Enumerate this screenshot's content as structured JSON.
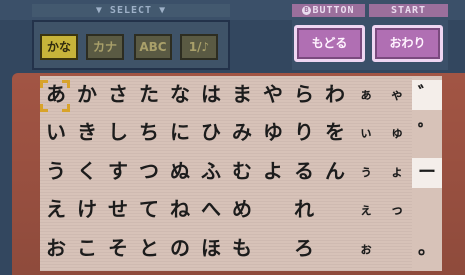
{
  "header": {
    "select_label": "▼ SELECT ▼",
    "button_letter": "B",
    "button_label": "BUTTON",
    "start_label": "START"
  },
  "modes": [
    {
      "label": "かな",
      "active": true
    },
    {
      "label": "カナ",
      "active": false
    },
    {
      "label": "ABC",
      "active": false
    },
    {
      "label": "1/♪",
      "active": false
    }
  ],
  "actions": {
    "back_label": "もどる",
    "done_label": "おわり"
  },
  "grid": [
    [
      "あ",
      "か",
      "さ",
      "た",
      "な",
      "は",
      "ま",
      "や",
      "ら",
      "わ",
      "ぁ",
      "ゃ"
    ],
    [
      "い",
      "き",
      "し",
      "ち",
      "に",
      "ひ",
      "み",
      "ゆ",
      "り",
      "を",
      "ぃ",
      "ゅ"
    ],
    [
      "う",
      "く",
      "す",
      "つ",
      "ぬ",
      "ふ",
      "む",
      "よ",
      "る",
      "ん",
      "ぅ",
      "ょ"
    ],
    [
      "え",
      "け",
      "せ",
      "て",
      "ね",
      "へ",
      "め",
      "",
      "れ",
      "",
      "ぇ",
      "っ"
    ],
    [
      "お",
      "こ",
      "そ",
      "と",
      "の",
      "ほ",
      "も",
      "",
      "ろ",
      "",
      "ぉ",
      ""
    ]
  ],
  "side": [
    "゛",
    "゜",
    "ー",
    "",
    "。"
  ],
  "colors": {
    "active_mode": "#c7b43a",
    "action_button": "#b06fb3",
    "grid_bg": "#d7c2b8",
    "card": "#a25544"
  }
}
